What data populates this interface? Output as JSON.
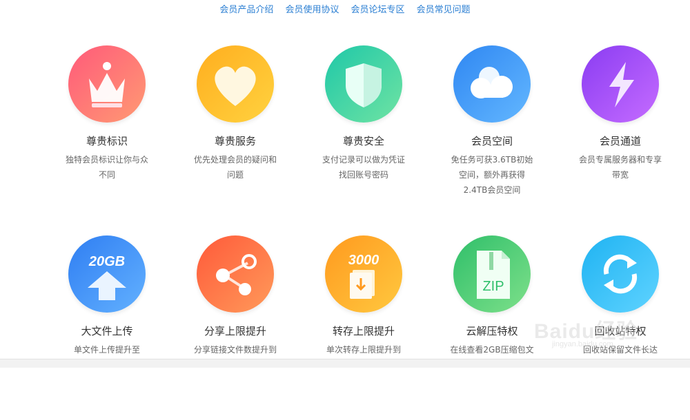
{
  "nav": {
    "links": [
      "会员产品介绍",
      "会员使用协议",
      "会员论坛专区",
      "会员常见问题"
    ]
  },
  "features": [
    {
      "title": "尊贵标识",
      "desc": [
        "独特会员标识让你与众",
        "不同"
      ],
      "icon": "crown-icon",
      "colors": [
        "#ff5a7a",
        "#ff9a73"
      ]
    },
    {
      "title": "尊贵服务",
      "desc": [
        "优先处理会员的疑问和",
        "问题"
      ],
      "icon": "heart-icon",
      "colors": [
        "#ffae1f",
        "#ffd23f"
      ]
    },
    {
      "title": "尊贵安全",
      "desc": [
        "支付记录可以做为凭证",
        "找回账号密码"
      ],
      "icon": "shield-icon",
      "colors": [
        "#1fc8a8",
        "#6fe3a3"
      ]
    },
    {
      "title": "会员空间",
      "desc": [
        "免任务可获3.6TB初始",
        "空间，额外再获得",
        "2.4TB会员空间"
      ],
      "icon": "cloud-icon",
      "colors": [
        "#2f87f2",
        "#63b7ff"
      ]
    },
    {
      "title": "会员通道",
      "desc": [
        "会员专属服务器和专享",
        "带宽"
      ],
      "icon": "lightning-icon",
      "colors": [
        "#8a3cf2",
        "#c56cff"
      ]
    },
    {
      "title": "大文件上传",
      "desc": [
        "单文件上传提升至"
      ],
      "icon": "upload-icon",
      "label": "20GB",
      "colors": [
        "#2f7ef2",
        "#63b1ff"
      ]
    },
    {
      "title": "分享上限提升",
      "desc": [
        "分享链接文件数提升到"
      ],
      "icon": "share-icon",
      "colors": [
        "#ff5a3a",
        "#ff9a5a"
      ]
    },
    {
      "title": "转存上限提升",
      "desc": [
        "单次转存上限提升到"
      ],
      "icon": "save-icon",
      "label": "3000",
      "colors": [
        "#ff9a1f",
        "#ffc83f"
      ]
    },
    {
      "title": "云解压特权",
      "desc": [
        "在线查看2GB压缩包文"
      ],
      "icon": "zip-icon",
      "label": "ZIP",
      "colors": [
        "#2fbf6a",
        "#7ee08a"
      ]
    },
    {
      "title": "回收站特权",
      "desc": [
        "回收站保留文件长达"
      ],
      "icon": "recycle-icon",
      "colors": [
        "#1fb3f2",
        "#5fd3ff"
      ]
    }
  ],
  "watermark": {
    "text": "Baidu经验",
    "sub": "jingyan.baidu.com"
  }
}
